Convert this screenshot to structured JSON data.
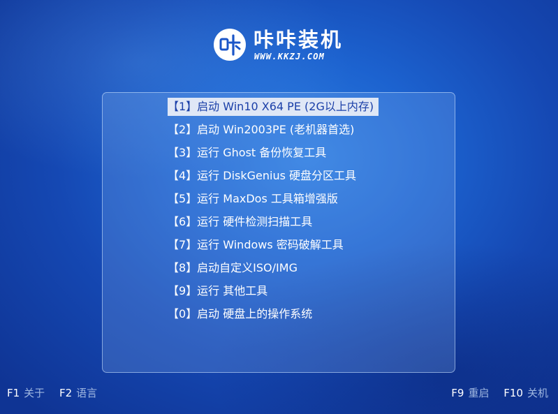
{
  "brand": {
    "logo_text": "咔",
    "name": "咔咔装机",
    "url": "WWW.KKZJ.COM"
  },
  "menu": {
    "selected_index": 0,
    "items": [
      {
        "label": "【1】启动 Win10 X64 PE (2G以上内存)"
      },
      {
        "label": "【2】启动 Win2003PE (老机器首选)"
      },
      {
        "label": "【3】运行 Ghost 备份恢复工具"
      },
      {
        "label": "【4】运行 DiskGenius 硬盘分区工具"
      },
      {
        "label": "【5】运行 MaxDos 工具箱增强版"
      },
      {
        "label": "【6】运行 硬件检测扫描工具"
      },
      {
        "label": "【7】运行 Windows 密码破解工具"
      },
      {
        "label": "【8】启动自定义ISO/IMG"
      },
      {
        "label": "【9】运行 其他工具"
      },
      {
        "label": "【0】启动 硬盘上的操作系统"
      }
    ]
  },
  "footer": {
    "left": [
      {
        "key": "F1",
        "action": "关于"
      },
      {
        "key": "F2",
        "action": "语言"
      }
    ],
    "right": [
      {
        "key": "F9",
        "action": "重启"
      },
      {
        "key": "F10",
        "action": "关机"
      }
    ]
  },
  "colors": {
    "background": "#1c62cf",
    "selection_bg": "#dfe7f6",
    "selection_text": "#1a3fa8",
    "footer_action": "#9fb7e0"
  }
}
